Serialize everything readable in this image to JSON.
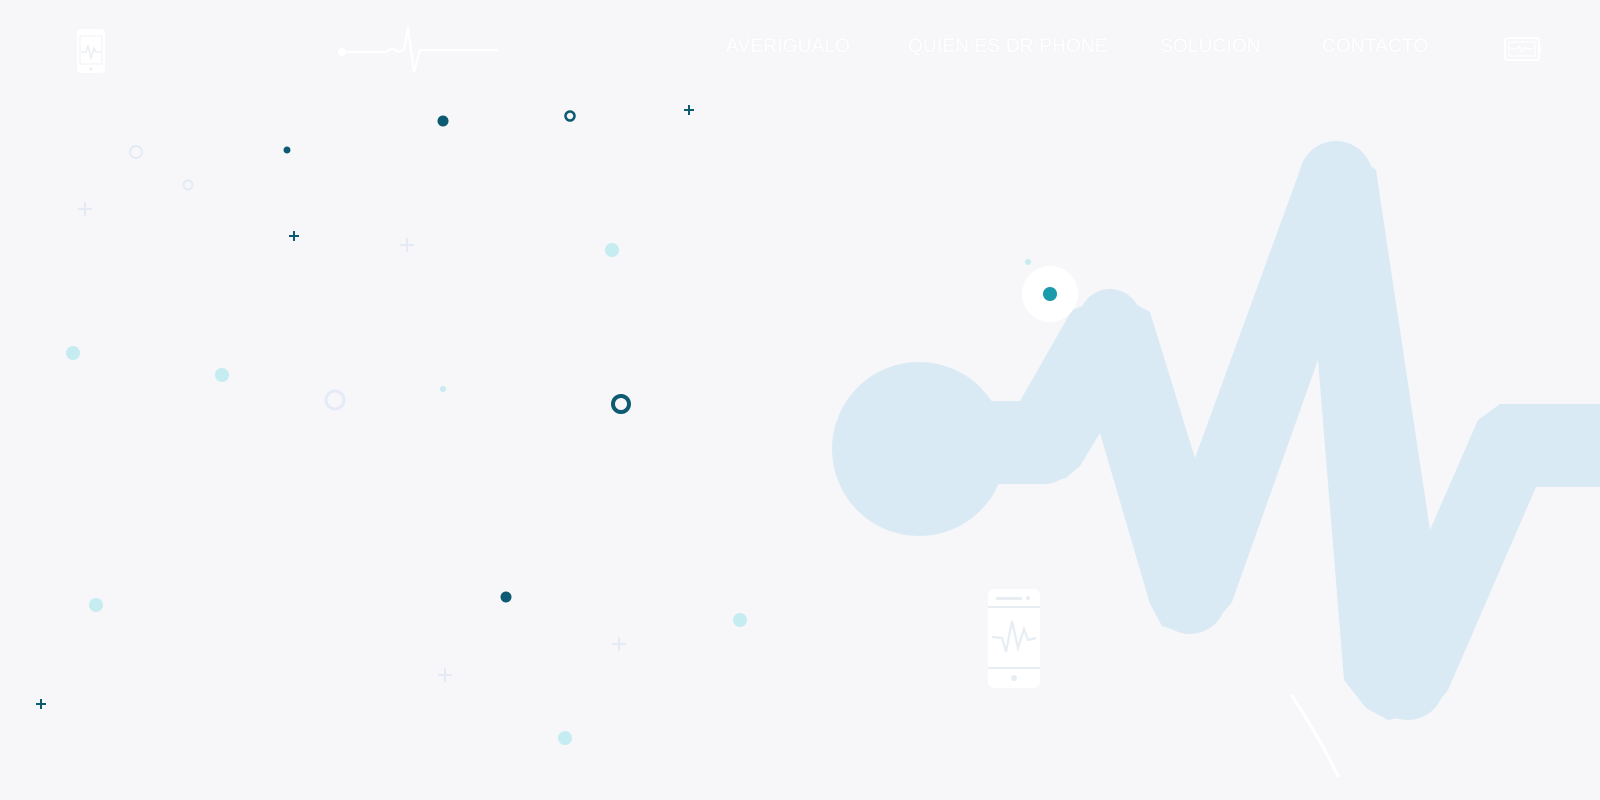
{
  "brand": {
    "logo_icon": "phone-heartbeat-icon",
    "pulse_icon": "heartbeat-line-icon"
  },
  "nav": {
    "items": [
      {
        "label": "AVERÍGUALO"
      },
      {
        "label": "QUIÉN ES DR PHONE"
      },
      {
        "label": "SOLUCIÓN"
      },
      {
        "label": "CONTACTO"
      }
    ],
    "cta_icon": "monitor-heartbeat-icon"
  },
  "hero": {
    "art_icon": "heartbeat-wave-graphic",
    "phone_icon": "phone-heartbeat-icon"
  },
  "colors": {
    "background": "#f7f7f9",
    "wave": "#d9eaf5",
    "dark_dot": "#0d5a73",
    "light_dot": "#c5ecf1",
    "accent_dot": "#1a9aaa",
    "faint": "#e4ebf6"
  }
}
